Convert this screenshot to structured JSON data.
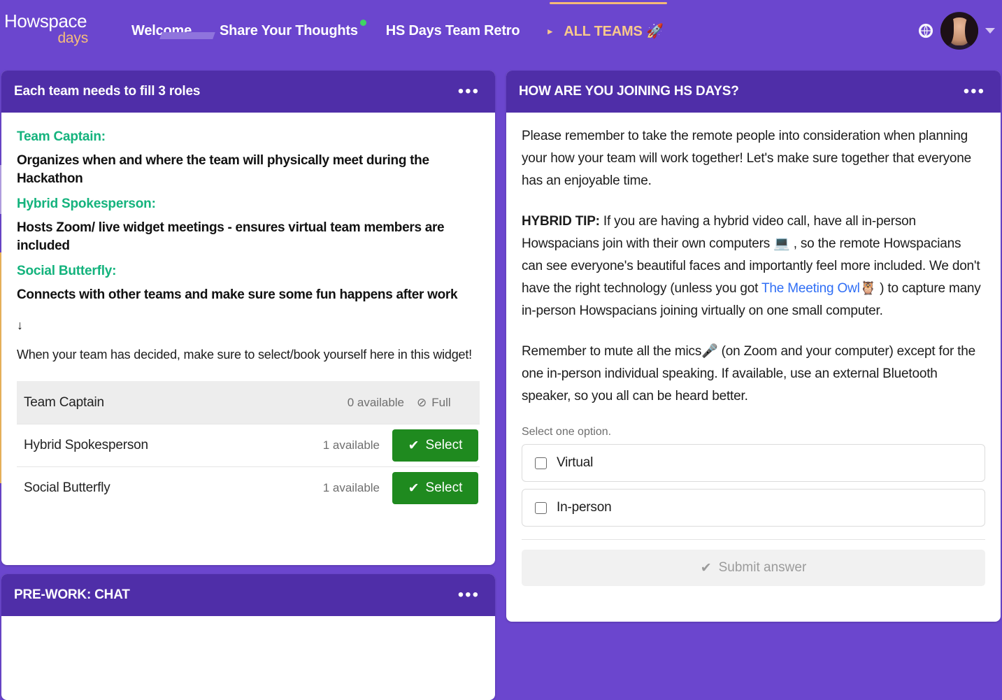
{
  "brand": {
    "logo_main": "Howspace",
    "logo_sub": "days",
    "purple": "#6b46ce",
    "header_purple": "#4f2ea8",
    "accent_orange": "#f6bd7b",
    "teal": "#14b37d",
    "green": "#1f8a1f",
    "link_blue": "#2f6ef5"
  },
  "navbar": {
    "items": [
      {
        "label": "Welcome",
        "active": true,
        "dot": false
      },
      {
        "label": "Share Your Thoughts",
        "active": false,
        "dot": true
      },
      {
        "label": "HS Days Team Retro",
        "active": false,
        "dot": false
      },
      {
        "label": "ALL TEAMS 🚀",
        "active": false,
        "dot": false,
        "highlight": true,
        "caret": "▸"
      }
    ],
    "globe_icon": "globe-icon",
    "avatar_alt": "user-avatar",
    "chevron": "chevron-down-icon"
  },
  "roles_card": {
    "title": "Each team needs to fill 3 roles",
    "menu": "•••",
    "roles": [
      {
        "head": "Team Captain:",
        "desc": "Organizes when and where the team will physically meet during the Hackathon"
      },
      {
        "head": "Hybrid Spokesperson:",
        "desc": "Hosts Zoom/ live widget meetings - ensures virtual team members are included"
      },
      {
        "head": "Social Butterfly:",
        "desc": "Connects with other teams and make sure some fun happens after work"
      }
    ],
    "arrow": "↓",
    "note": "When your team has decided, make sure to select/book yourself here in this widget!",
    "table": [
      {
        "name": "Team Captain",
        "available": "0 available",
        "status": "Full",
        "status_icon": "⊘",
        "full": true,
        "action": null
      },
      {
        "name": "Hybrid Spokesperson",
        "available": "1 available",
        "status": null,
        "status_icon": null,
        "full": false,
        "action": "Select"
      },
      {
        "name": "Social Butterfly",
        "available": "1 available",
        "status": null,
        "status_icon": null,
        "full": false,
        "action": "Select"
      }
    ]
  },
  "chat_card": {
    "title": "PRE-WORK: CHAT",
    "menu": "•••"
  },
  "join_card": {
    "title": "HOW ARE YOU JOINING HS DAYS?",
    "menu": "•••",
    "p1": "Please remember to take the remote people into consideration when planning your how your team will work together! Let's make sure together that everyone has an enjoyable time.",
    "p2_bold": "HYBRID TIP:",
    "p2_a": " If you are having a hybrid video call, have all in-person Howspacians join with their own computers 💻 , so the remote Howspacians can see everyone's beautiful faces and importantly feel more included. We don't have the right technology (unless you got ",
    "p2_link": "The Meeting Owl",
    "p2_emoji": "🦉",
    "p2_b": " ) to capture many in-person Howspacians joining virtually on one small computer.",
    "p3": "Remember to mute all the mics🎤 (on Zoom and your computer) except for the one in-person individual speaking. If available, use an external Bluetooth speaker, so you all can be heard better.",
    "select_hint": "Select one option.",
    "options": [
      {
        "label": "Virtual",
        "checked": false
      },
      {
        "label": "In-person",
        "checked": false
      }
    ],
    "submit_label": "Submit answer",
    "submit_icon": "✔",
    "submit_disabled": true
  }
}
